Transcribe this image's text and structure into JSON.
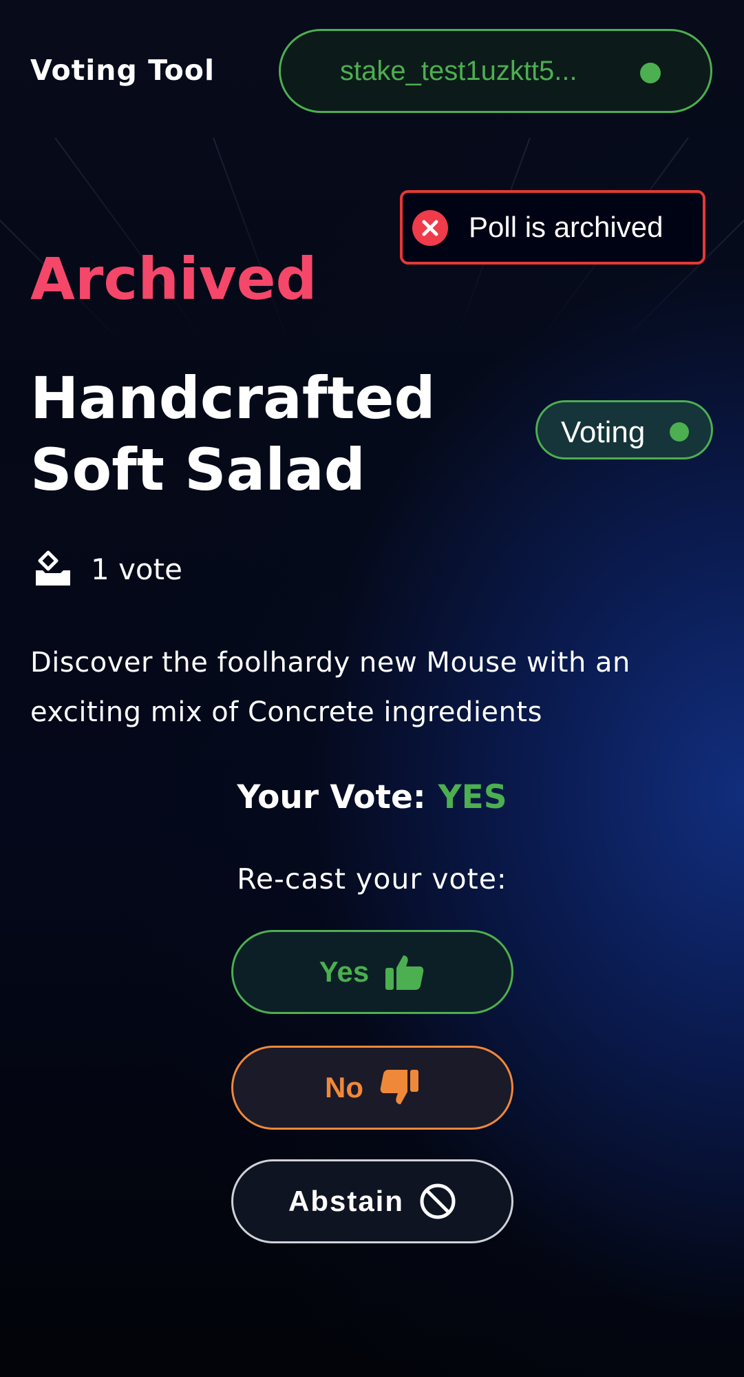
{
  "header": {
    "app_title": "Voting Tool",
    "wallet_address": "stake_test1uzktt5...",
    "wallet_status_color": "#4caf50"
  },
  "toast": {
    "message": "Poll is archived",
    "icon": "close-circle-icon",
    "color": "#e53935"
  },
  "poll": {
    "status_heading": "Archived",
    "status_color": "#f5476a",
    "title": "Handcrafted Soft Salad",
    "badge_label": "Voting",
    "vote_count": "1 vote",
    "description": "Discover the foolhardy new Mouse with an exciting mix of Concrete ingredients"
  },
  "your_vote": {
    "label": "Your Vote:",
    "value": "YES"
  },
  "recast": {
    "label": "Re-cast your vote:",
    "buttons": [
      {
        "label": "Yes",
        "icon": "thumbs-up-icon",
        "color": "#4caf50"
      },
      {
        "label": "No",
        "icon": "thumbs-down-icon",
        "color": "#f0883a"
      },
      {
        "label": "Abstain",
        "icon": "ban-icon",
        "color": "#ffffff"
      }
    ]
  }
}
